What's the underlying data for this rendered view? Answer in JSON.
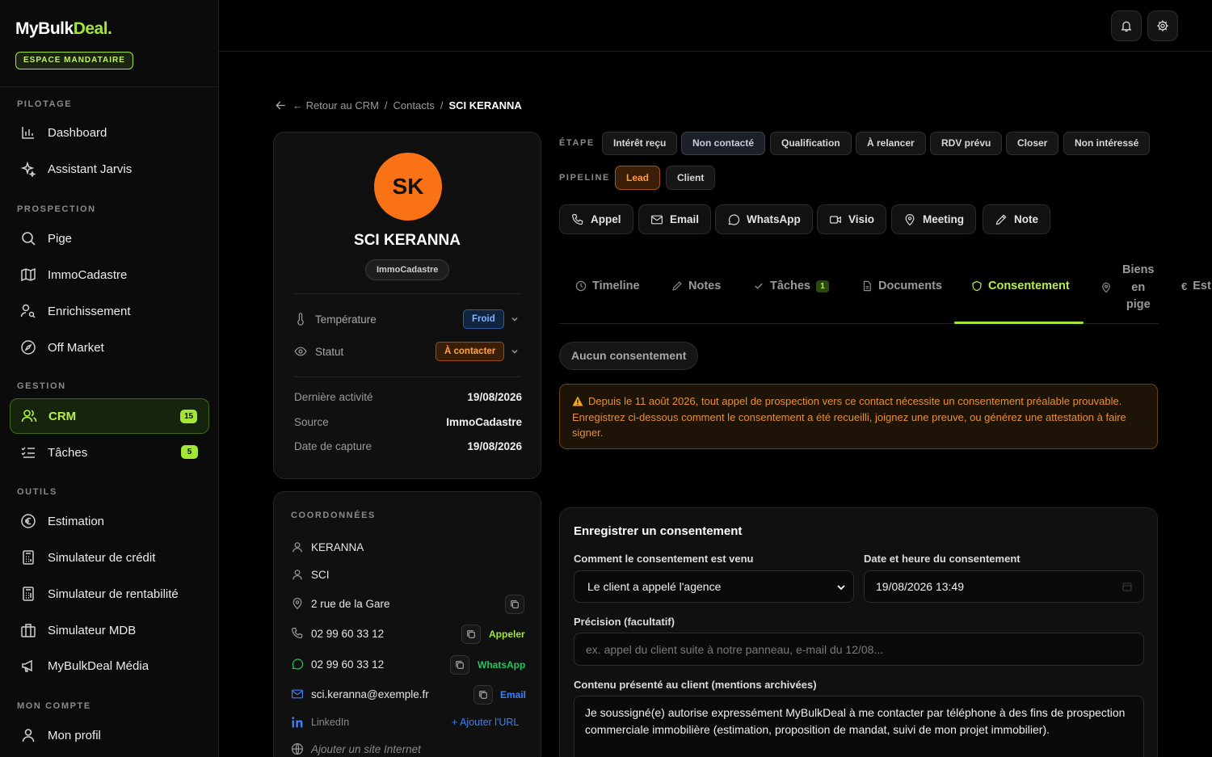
{
  "app": {
    "logo_main": "MyBulk",
    "logo_accent": "Deal",
    "logo_dot": ".",
    "espace": "ESPACE MANDATAIRE"
  },
  "sidebar": {
    "sections": [
      "PILOTAGE",
      "PROSPECTION",
      "GESTION",
      "OUTILS",
      "MON COMPTE"
    ],
    "items": [
      {
        "label": "Dashboard",
        "icon": "bar-chart-icon"
      },
      {
        "label": "Assistant Jarvis",
        "icon": "sparkles-icon"
      },
      {
        "label": "Pige",
        "icon": "search-icon"
      },
      {
        "label": "ImmoCadastre",
        "icon": "map-icon"
      },
      {
        "label": "Enrichissement",
        "icon": "user-search-icon"
      },
      {
        "label": "Off Market",
        "icon": "compass-icon"
      },
      {
        "label": "CRM",
        "icon": "users-icon",
        "badge": "15"
      },
      {
        "label": "Tâches",
        "icon": "checklist-icon",
        "badge": "5"
      },
      {
        "label": "Estimation",
        "icon": "euro-icon"
      },
      {
        "label": "Simulateur de crédit",
        "icon": "calculator-icon"
      },
      {
        "label": "Simulateur de rentabilité",
        "icon": "calculator-icon"
      },
      {
        "label": "Simulateur MDB",
        "icon": "building-icon"
      },
      {
        "label": "MyBulkDeal Média",
        "icon": "megaphone-icon"
      },
      {
        "label": "Mon profil",
        "icon": "user-icon"
      }
    ]
  },
  "breadcrumb": {
    "back": "← Retour au CRM",
    "sep": "/",
    "contacts": "Contacts",
    "current": "SCI KERANNA"
  },
  "profile": {
    "initials": "SK",
    "name": "SCI KERANNA",
    "source_pill": "ImmoCadastre",
    "temperature_label": "Température",
    "temperature_value": "Froid",
    "statut_label": "Statut",
    "statut_value": "À contacter",
    "derniere_label": "Dernière activité",
    "derniere_value": "19/08/2026",
    "source_label": "Source",
    "source_value": "ImmoCadastre",
    "capture_label": "Date de capture",
    "capture_value": "19/08/2026"
  },
  "coordonnees": {
    "title": "COORDONNÉES",
    "nom": "KERANNA",
    "type": "SCI",
    "adresse": "2 rue de la Gare",
    "tel1": "02 99 60 33 12",
    "tel1_action": "Appeler",
    "tel2": "02 99 60 33 12",
    "tel2_action": "WhatsApp",
    "email": "sci.keranna@exemple.fr",
    "email_action": "Email",
    "linkedin": "LinkedIn",
    "linkedin_action": "+ Ajouter l'URL",
    "website": "Ajouter un site Internet"
  },
  "etape": {
    "label": "ÉTAPE",
    "stages": [
      "Intérêt reçu",
      "Non contacté",
      "Qualification",
      "À relancer",
      "RDV prévu",
      "Closer",
      "Non intéressé"
    ],
    "selected": "Non contacté"
  },
  "pipeline": {
    "label": "PIPELINE",
    "options": [
      "Lead",
      "Client"
    ],
    "selected": "Lead"
  },
  "actions": [
    "Appel",
    "Email",
    "WhatsApp",
    "Visio",
    "Meeting",
    "Note"
  ],
  "tabs": {
    "timeline": "Timeline",
    "notes": "Notes",
    "taches": "Tâches",
    "taches_count": "1",
    "documents": "Documents",
    "consentement": "Consentement",
    "biens_1": "Biens",
    "biens_2": "en",
    "biens_3": "pige",
    "est": "Est"
  },
  "consent": {
    "status": "Aucun consentement",
    "warning": "Depuis le 11 août 2026, tout appel de prospection vers ce contact nécessite un consentement préalable prouvable. Enregistrez ci-dessous comment le consentement a été recueilli, joignez une preuve, ou générez une attestation à faire signer.",
    "form_title": "Enregistrer un consentement",
    "how_label": "Comment le consentement est venu",
    "how_value": "Le client a appelé l'agence",
    "date_label": "Date et heure du consentement",
    "date_value": "19/08/2026 13:49",
    "precision_label": "Précision (facultatif)",
    "precision_placeholder": "ex. appel du client suite à notre panneau, e-mail du 12/08...",
    "content_label": "Contenu présenté au client (mentions archivées)",
    "content_value": "Je soussigné(e) autorise expressément MyBulkDeal à me contacter par téléphone à des fins de prospection commerciale immobilière (estimation, proposition de mandat, suivi de mon projet immobilier)."
  },
  "colors": {
    "accent": "#a3e635",
    "orange": "#f97316",
    "blue": "#2f5ea0"
  }
}
